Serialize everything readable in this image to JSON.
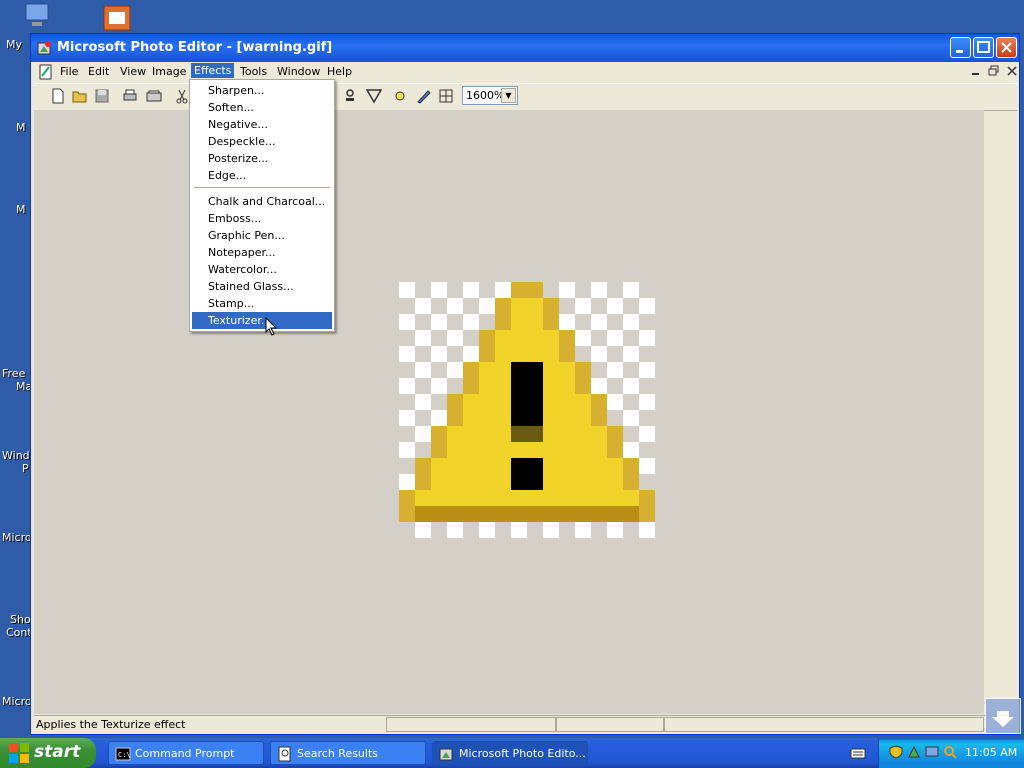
{
  "window": {
    "title": "Microsoft Photo Editor - [warning.gif]"
  },
  "menubar": {
    "items": [
      "File",
      "Edit",
      "View",
      "Image",
      "Effects",
      "Tools",
      "Window",
      "Help"
    ],
    "active": "Effects"
  },
  "toolbar": {
    "zoom": "1600%"
  },
  "effects_menu": {
    "group1": [
      "Sharpen...",
      "Soften...",
      "Negative...",
      "Despeckle...",
      "Posterize...",
      "Edge..."
    ],
    "group2": [
      "Chalk and Charcoal...",
      "Emboss...",
      "Graphic Pen...",
      "Notepaper...",
      "Watercolor...",
      "Stained Glass...",
      "Stamp...",
      "Texturizer..."
    ],
    "highlighted": "Texturizer..."
  },
  "statusbar": {
    "text": "Applies the Texturize effect"
  },
  "desktop": {
    "icon_labels": [
      "My",
      "M",
      "M",
      "Free",
      "Ma",
      "Windo",
      "P",
      "Micros",
      "Sho",
      "Cont",
      "Micros"
    ]
  },
  "taskbar": {
    "start_label": "start",
    "tasks": [
      {
        "label": "Command Prompt",
        "icon": "cmd-icon",
        "active": false
      },
      {
        "label": "Search Results",
        "icon": "search-results-icon",
        "active": false
      },
      {
        "label": "Microsoft Photo Edito...",
        "icon": "photo-editor-icon",
        "active": true
      }
    ],
    "clock": "11:05 AM"
  },
  "colors": {
    "accent": "#316ac5",
    "titlebar": "#0a5bdc",
    "warning_yellow": "#f1d32a",
    "warning_dark": "#b88f14"
  }
}
